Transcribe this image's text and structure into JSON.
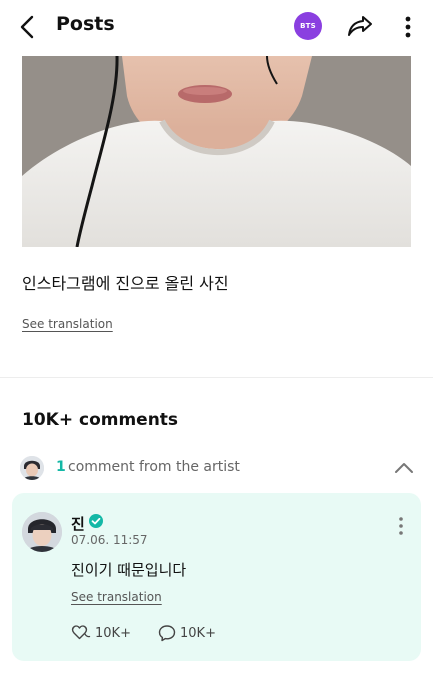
{
  "header": {
    "title": "Posts",
    "badge_label": "BTS"
  },
  "post": {
    "text": "인스타그램에 진으로 올린 사진",
    "see_translation": "See translation"
  },
  "comments": {
    "count_label": "10K+ comments",
    "artist_count": "1",
    "artist_label": "comment from the artist"
  },
  "comment": {
    "author": "진",
    "date": "07.06. 11:57",
    "text": "진이기 때문입니다",
    "see_translation": "See translation",
    "likes": "10K+",
    "replies": "10K+"
  },
  "colors": {
    "accent": "#14b8a6",
    "badge": "#8a3fe0",
    "card_bg": "#e8faf5"
  }
}
